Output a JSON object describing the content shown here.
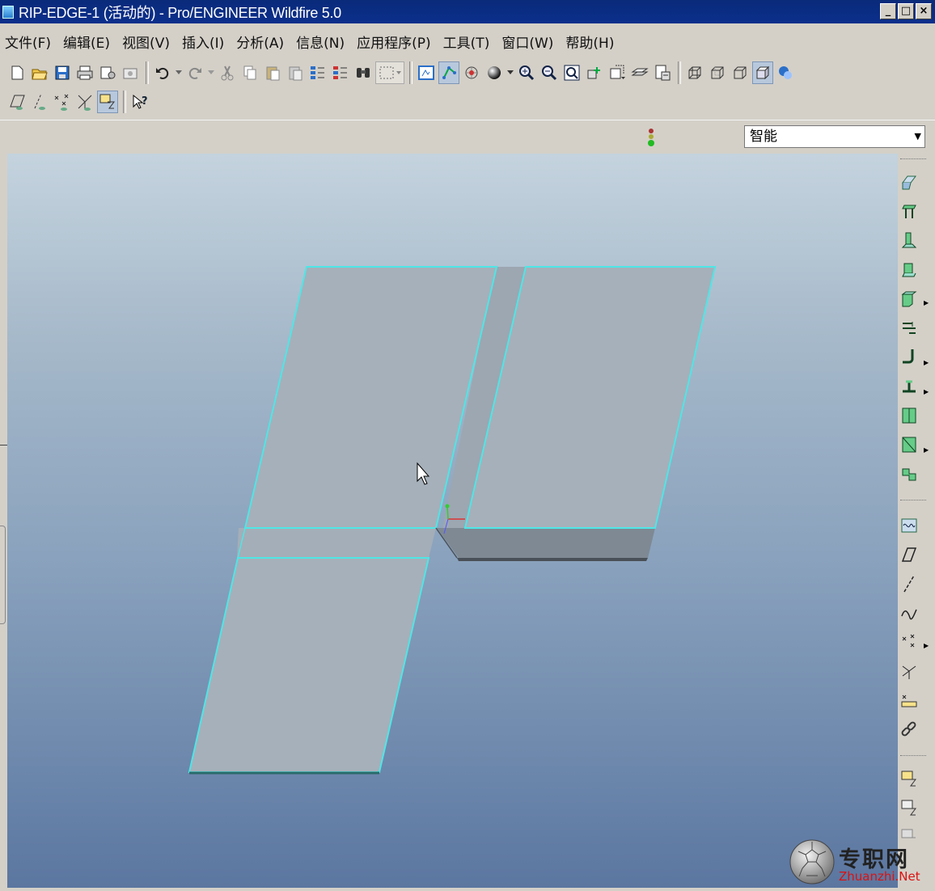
{
  "window": {
    "title": "RIP-EDGE-1 (活动的) - Pro/ENGINEER Wildfire 5.0",
    "buttons": {
      "minimize": "_",
      "maximize": "□",
      "close": "×"
    }
  },
  "menu": [
    {
      "label": "文件(F)"
    },
    {
      "label": "编辑(E)"
    },
    {
      "label": "视图(V)"
    },
    {
      "label": "插入(I)"
    },
    {
      "label": "分析(A)"
    },
    {
      "label": "信息(N)"
    },
    {
      "label": "应用程序(P)"
    },
    {
      "label": "工具(T)"
    },
    {
      "label": "窗口(W)"
    },
    {
      "label": "帮助(H)"
    }
  ],
  "toolbar_top": [
    "new-icon",
    "open-icon",
    "save-icon",
    "print-icon",
    "email-icon",
    "email-link-icon",
    "undo-icon",
    "redo-icon",
    "cut-icon",
    "copy-icon",
    "paste-icon",
    "paste-special-icon",
    "regenerate-icon",
    "regen-manager-icon",
    "find-icon",
    "select-box-icon",
    "redraw-icon",
    "spin-center-icon",
    "orient-icon",
    "model-display-icon",
    "zoom-in-icon",
    "zoom-out-icon",
    "refit-icon",
    "reorient-icon",
    "saved-views-icon",
    "layers-icon",
    "view-manager-icon",
    "wireframe-icon",
    "hidden-line-icon",
    "no-hidden-icon",
    "shading-icon",
    "appearance-icon"
  ],
  "toolbar_second": [
    "datum-plane-display-icon",
    "datum-axis-display-icon",
    "datum-point-display-icon",
    "coordsys-display-icon",
    "annotation-display-icon",
    "whats-this-help-icon"
  ],
  "filter": {
    "selected": "智能"
  },
  "watermark": {
    "brand": "专职网",
    "site": "Zhuanzhi.Net"
  }
}
